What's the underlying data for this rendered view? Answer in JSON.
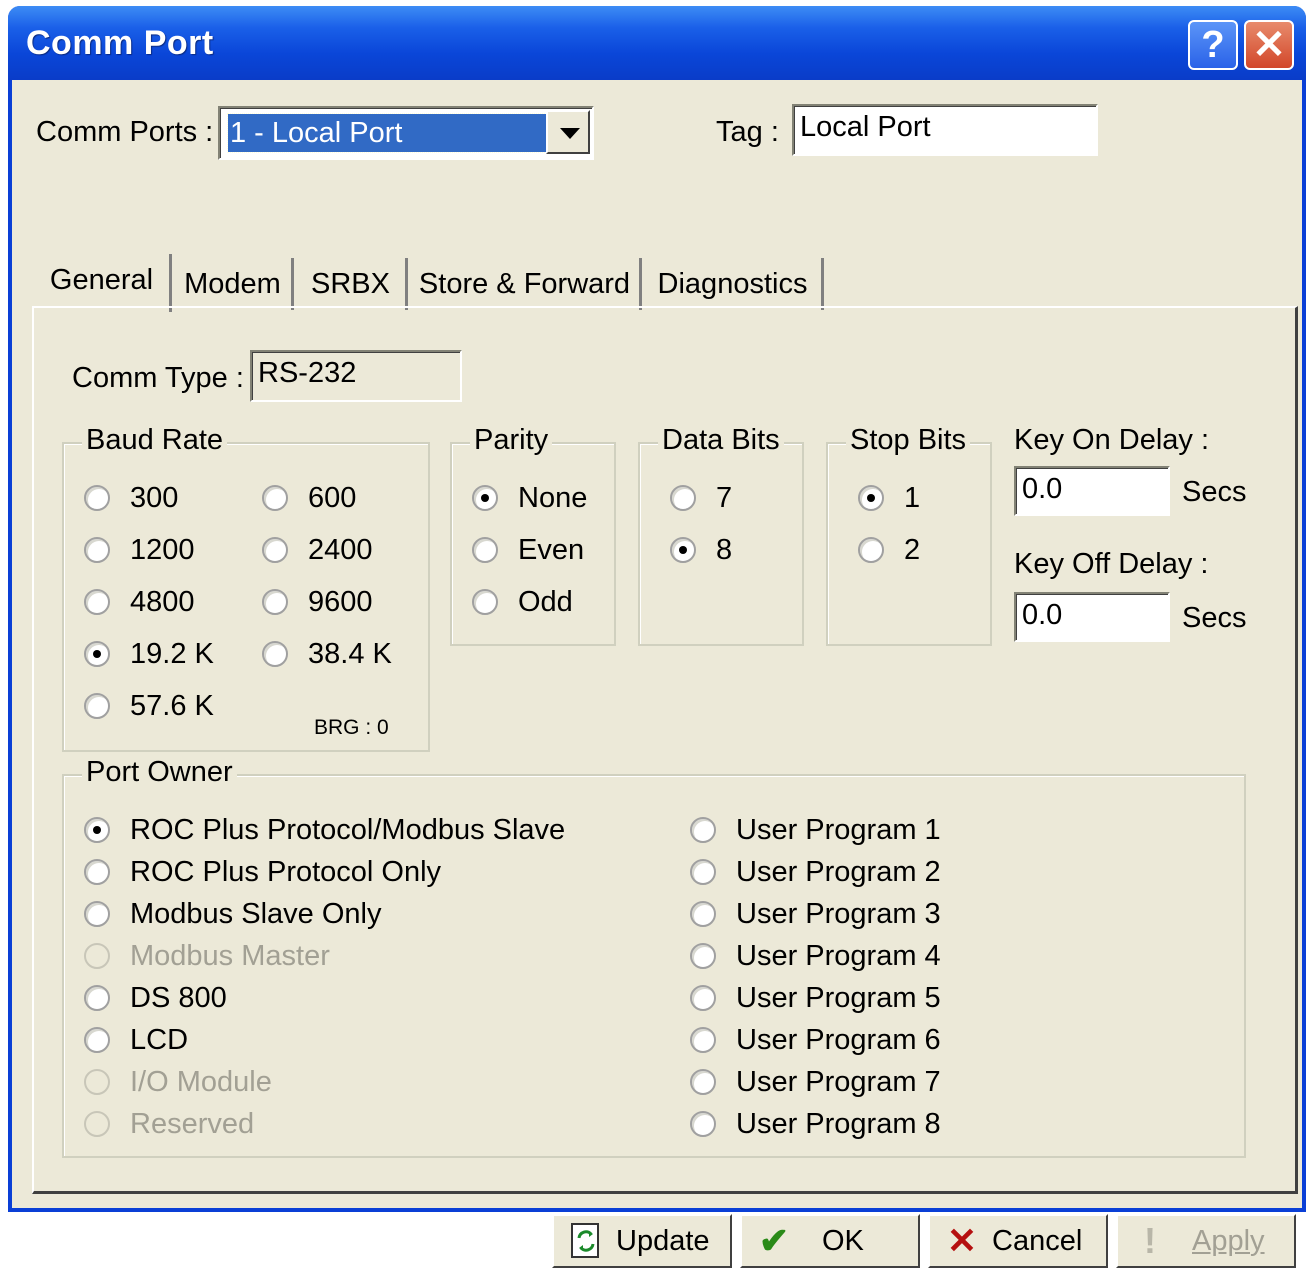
{
  "window": {
    "title": "Comm Port"
  },
  "titlebar": {
    "help_glyph": "?",
    "close_glyph": "✕"
  },
  "top": {
    "comm_ports_label": "Comm Ports :",
    "comm_ports_value": "1 - Local Port",
    "tag_label": "Tag :",
    "tag_value": "Local Port"
  },
  "tabs": [
    "General",
    "Modem",
    "SRBX",
    "Store & Forward",
    "Diagnostics"
  ],
  "general": {
    "comm_type_label": "Comm Type :",
    "comm_type_value": "RS-232",
    "baud": {
      "title": "Baud Rate",
      "options": [
        "300",
        "600",
        "1200",
        "2400",
        "4800",
        "9600",
        "19.2 K",
        "38.4 K",
        "57.6 K"
      ],
      "selected": "19.2 K",
      "brg_label": "BRG : 0"
    },
    "parity": {
      "title": "Parity",
      "options": [
        "None",
        "Even",
        "Odd"
      ],
      "selected": "None"
    },
    "data_bits": {
      "title": "Data Bits",
      "options": [
        "7",
        "8"
      ],
      "selected": "8"
    },
    "stop_bits": {
      "title": "Stop Bits",
      "options": [
        "1",
        "2"
      ],
      "selected": "1"
    },
    "key_on": {
      "label": "Key On Delay :",
      "value": "0.0",
      "unit": "Secs"
    },
    "key_off": {
      "label": "Key Off Delay :",
      "value": "0.0",
      "unit": "Secs"
    },
    "port_owner": {
      "title": "Port Owner",
      "left": [
        "ROC Plus Protocol/Modbus Slave",
        "ROC Plus Protocol Only",
        "Modbus Slave Only",
        "Modbus Master",
        "DS 800",
        "LCD",
        "I/O Module",
        "Reserved"
      ],
      "right": [
        "User Program 1",
        "User Program 2",
        "User Program 3",
        "User Program 4",
        "User Program 5",
        "User Program 6",
        "User Program 7",
        "User Program 8"
      ],
      "selected": "ROC Plus Protocol/Modbus Slave",
      "disabled": [
        "Modbus Master",
        "I/O Module",
        "Reserved"
      ]
    }
  },
  "buttons": {
    "update": {
      "label": "Update",
      "icon": "refresh-icon"
    },
    "ok": {
      "label": "OK",
      "icon": "checkmark-icon"
    },
    "cancel": {
      "label": "Cancel",
      "icon": "x-icon"
    },
    "apply": {
      "label": "Apply",
      "icon": "exclamation-icon"
    }
  },
  "colors": {
    "title_bar": "#0a46d8",
    "face": "#ece9d8",
    "selection": "#316ac5",
    "ok_green": "#2a8a18",
    "cancel_red": "#b51010"
  }
}
